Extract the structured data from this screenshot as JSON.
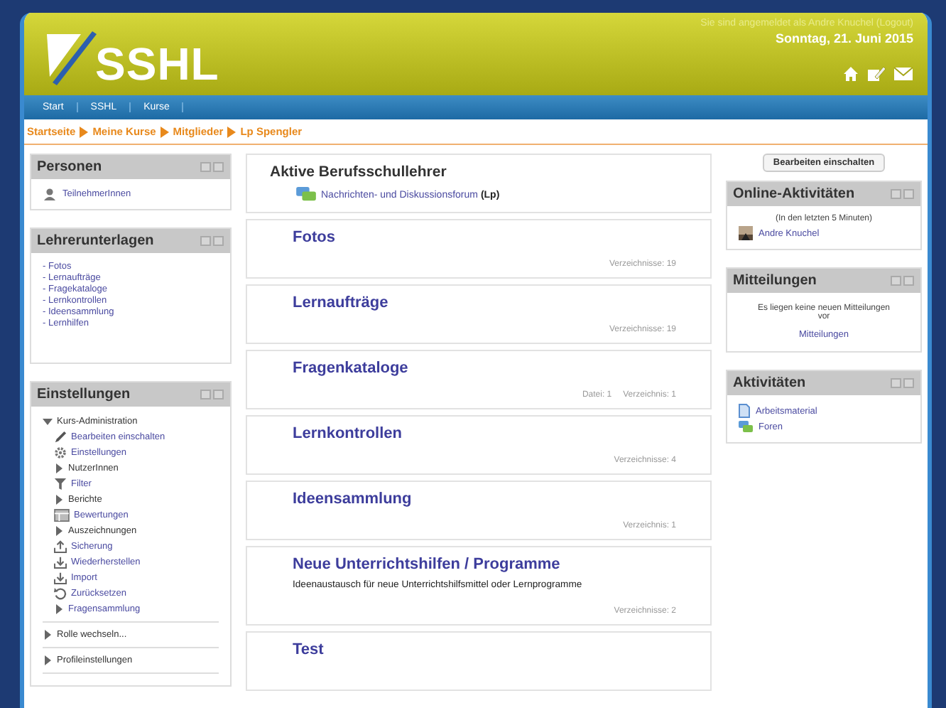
{
  "header": {
    "logo": "SSHL",
    "login_text": "Sie sind angemeldet als Andre Knuchel (Logout)",
    "date": "Sonntag, 21. Juni 2015"
  },
  "nav": [
    "Start",
    "SSHL",
    "Kurse"
  ],
  "breadcrumb": [
    "Startseite",
    "Meine Kurse",
    "Mitglieder",
    "Lp Spengler"
  ],
  "left_blocks": [
    {
      "title": "Personen",
      "kind": "links",
      "items": [
        "TeilnehmerInnen"
      ]
    },
    {
      "title": "Lehrerunterlagen",
      "kind": "list",
      "items": [
        "- Fotos",
        "- Lernaufträge",
        "- Fragekataloge",
        "- Lernkontrollen",
        "- Ideensammlung",
        "- Lernhilfen"
      ]
    },
    {
      "title": "Einstellungen",
      "kind": "tree",
      "tree": [
        {
          "text": "Kurs-Administration",
          "kind": "branch",
          "expanded": true,
          "link": false,
          "children": [
            {
              "text": "Bearbeiten einschalten",
              "kind": "pencil",
              "link": true
            },
            {
              "text": "Einstellungen",
              "kind": "gear",
              "link": true
            },
            {
              "text": "NutzerInnen",
              "kind": "branch",
              "expanded": false,
              "link": false
            },
            {
              "text": "Filter",
              "kind": "filter",
              "link": true
            },
            {
              "text": "Berichte",
              "kind": "branch",
              "expanded": false,
              "link": false
            },
            {
              "text": "Bewertungen",
              "kind": "grades",
              "link": true
            },
            {
              "text": "Auszeichnungen",
              "kind": "branch",
              "expanded": false,
              "link": false
            },
            {
              "text": "Sicherung",
              "kind": "upload",
              "link": true
            },
            {
              "text": "Wiederherstellen",
              "kind": "download",
              "link": true
            },
            {
              "text": "Import",
              "kind": "download",
              "link": true
            },
            {
              "text": "Zurücksetzen",
              "kind": "reset",
              "link": true
            },
            {
              "text": "Fragensammlung",
              "kind": "branch",
              "expanded": false,
              "link": true
            }
          ]
        },
        {
          "text": "Rolle wechseln...",
          "kind": "branch",
          "expanded": false,
          "link": false
        },
        {
          "text": "Profileinstellungen",
          "kind": "branch",
          "expanded": false,
          "link": false
        }
      ]
    }
  ],
  "main": {
    "intro": {
      "title": "Aktive Berufsschullehrer",
      "activity": "Nachrichten- und Diskussionsforum **(Lp)**"
    },
    "sections": [
      {
        "title": "Fotos",
        "info": [
          "Verzeichnisse: 19"
        ]
      },
      {
        "title": "Lernaufträge",
        "info": [
          "Verzeichnisse: 19"
        ]
      },
      {
        "title": "Fragenkataloge",
        "info": [
          "Datei: 1",
          "Verzeichnis: 1"
        ]
      },
      {
        "title": "Lernkontrollen",
        "info": [
          "Verzeichnisse: 4"
        ]
      },
      {
        "title": "Ideensammlung",
        "info": [
          "Verzeichnis: 1"
        ]
      },
      {
        "title": "Neue Unterrichtshilfen / Programme",
        "summary": "Ideenaustausch für neue Unterrichtshilfsmittel oder Lernprogramme",
        "info": [
          "Verzeichnisse: 2"
        ]
      },
      {
        "title": "Test"
      }
    ]
  },
  "edit_button": "Bearbeiten einschalten",
  "right_blocks": [
    {
      "title": "Online-Aktivitäten",
      "kind": "online",
      "note": "(In den letzten 5 Minuten)",
      "user": "Andre Knuchel"
    },
    {
      "title": "Mitteilungen",
      "kind": "messages",
      "note": "Es liegen keine neuen Mitteilungen vor",
      "link": "Mitteilungen"
    },
    {
      "title": "Aktivitäten",
      "kind": "activities",
      "items": [
        {
          "text": "Arbeitsmaterial",
          "kind": "resource"
        },
        {
          "text": "Foren",
          "kind": "forum"
        }
      ]
    }
  ]
}
